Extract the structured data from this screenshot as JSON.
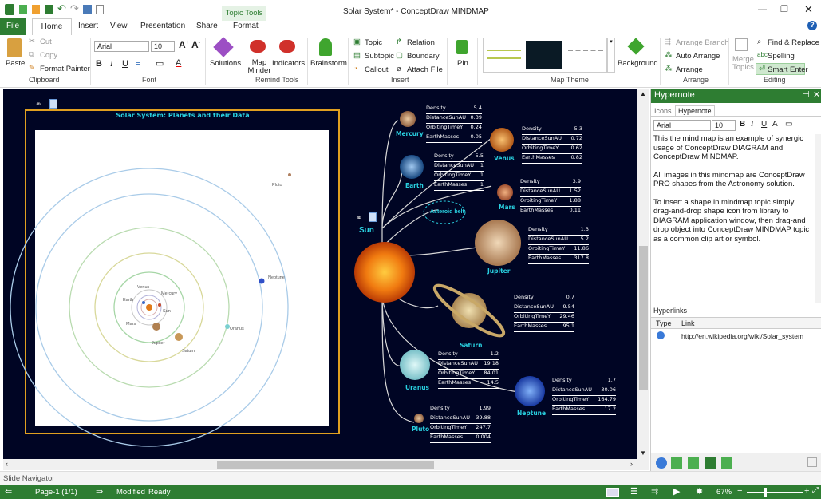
{
  "app": {
    "title": "Solar System* - ConceptDraw MINDMAP",
    "context_tab": "Topic Tools"
  },
  "tabs": [
    "File",
    "Home",
    "Insert",
    "View",
    "Presentation",
    "Share",
    "Format"
  ],
  "ribbon": {
    "clipboard": {
      "label": "Clipboard",
      "paste": "Paste",
      "cut": "Cut",
      "copy": "Copy",
      "format_painter": "Format Painter"
    },
    "font": {
      "label": "Font",
      "family": "Arial",
      "size": "10"
    },
    "solutions": "Solutions",
    "map_minder": "Map Minder",
    "indicators": "Indicators",
    "remind_label": "Remind Tools",
    "brainstorm": "Brainstorm",
    "insert": {
      "label": "Insert",
      "topic": "Topic",
      "subtopic": "Subtopic",
      "callout": "Callout",
      "relation": "Relation",
      "boundary": "Boundary",
      "attach": "Attach File"
    },
    "pin": "Pin",
    "map_theme": {
      "label": "Map Theme",
      "background": "Background"
    },
    "arrange": {
      "label": "Arrange",
      "branch": "Arrange Branch",
      "auto": "Auto Arrange",
      "arrange": "Arrange"
    },
    "editing": {
      "label": "Editing",
      "merge": "Merge Topics",
      "find": "Find & Replace",
      "spelling": "Spelling",
      "smart": "Smart Enter"
    }
  },
  "mindmap": {
    "root": "Sun",
    "orbit_title": "Solar System: Planets and their Data",
    "orbit_labels": [
      "Venus",
      "Mercury",
      "Earth",
      "Sun",
      "Mars",
      "Jupiter",
      "Saturn",
      "Uranus",
      "Neptune",
      "Pluto"
    ],
    "asteroid": "Asteroid belt",
    "keys": [
      "Density",
      "DistanceSunAU",
      "OrbitingTimeY",
      "EarthMasses"
    ],
    "planets": [
      {
        "name": "Mercury",
        "values": [
          "5.4",
          "0.39",
          "0.24",
          "0.05"
        ]
      },
      {
        "name": "Venus",
        "values": [
          "5.3",
          "0.72",
          "0.62",
          "0.82"
        ]
      },
      {
        "name": "Earth",
        "values": [
          "5.5",
          "1",
          "1",
          "1"
        ]
      },
      {
        "name": "Mars",
        "values": [
          "3.9",
          "1.52",
          "1.88",
          "0.11"
        ]
      },
      {
        "name": "Jupiter",
        "values": [
          "1.3",
          "5.2",
          "11.86",
          "317.8"
        ]
      },
      {
        "name": "Saturn",
        "values": [
          "0.7",
          "9.54",
          "29.46",
          "95.1"
        ]
      },
      {
        "name": "Uranus",
        "values": [
          "1.2",
          "19.18",
          "84.01",
          "14.5"
        ]
      },
      {
        "name": "Neptune",
        "values": [
          "1.7",
          "30.06",
          "164.79",
          "17.2"
        ]
      },
      {
        "name": "Pluto",
        "values": [
          "1.99",
          "39.88",
          "247.7",
          "0.004"
        ]
      }
    ]
  },
  "panel": {
    "title": "Hypernote",
    "tab_icons": "Icons",
    "tab_hyper": "Hypernote",
    "font": "Arial",
    "size": "10",
    "text1": "This the mind map is an example of synergic usage of ConceptDraw DIAGRAM and ConceptDraw MINDMAP.",
    "text2": "All images in this mindmap are ConceptDraw PRO shapes from the Astronomy solution.",
    "text3": "To insert a shape in mindmap topic simply drag-and-drop shape icon from library to DIAGRAM application window, then drag-and drop object into ConceptDraw MINDMAP topic as a common clip art or symbol.",
    "hyperlinks": "Hyperlinks",
    "col_type": "Type",
    "col_link": "Link",
    "link": "http://en.wikipedia.org/wiki/Solar_system"
  },
  "slide_nav": "Slide Navigator",
  "status": {
    "page": "Page-1 (1/1)",
    "modified": "Modified",
    "ready": "Ready",
    "zoom": "67%"
  }
}
